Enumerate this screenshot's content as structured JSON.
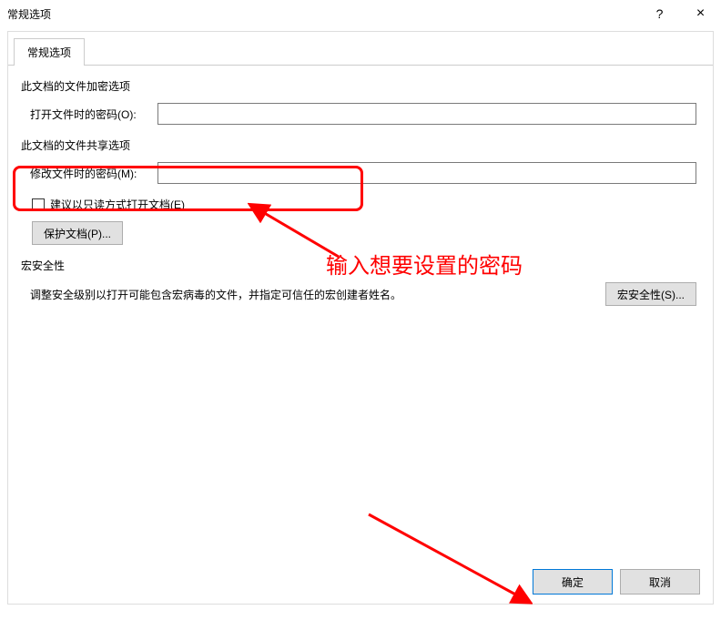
{
  "titlebar": {
    "title": "常规选项",
    "help": "?",
    "close": "×"
  },
  "tab": {
    "label": "常规选项"
  },
  "encrypt": {
    "section": "此文档的文件加密选项",
    "open_pwd_label": "打开文件时的密码(O):",
    "open_pwd_value": ""
  },
  "share": {
    "section": "此文档的文件共享选项",
    "modify_pwd_label": "修改文件时的密码(M):",
    "modify_pwd_value": "",
    "readonly_label": "建议以只读方式打开文档(E)",
    "protect_btn": "保护文档(P)..."
  },
  "macro": {
    "section": "宏安全性",
    "desc": "调整安全级别以打开可能包含宏病毒的文件，并指定可信任的宏创建者姓名。",
    "btn": "宏安全性(S)..."
  },
  "footer": {
    "ok": "确定",
    "cancel": "取消"
  },
  "annotation": {
    "text1": "输入想要设置的密码"
  }
}
